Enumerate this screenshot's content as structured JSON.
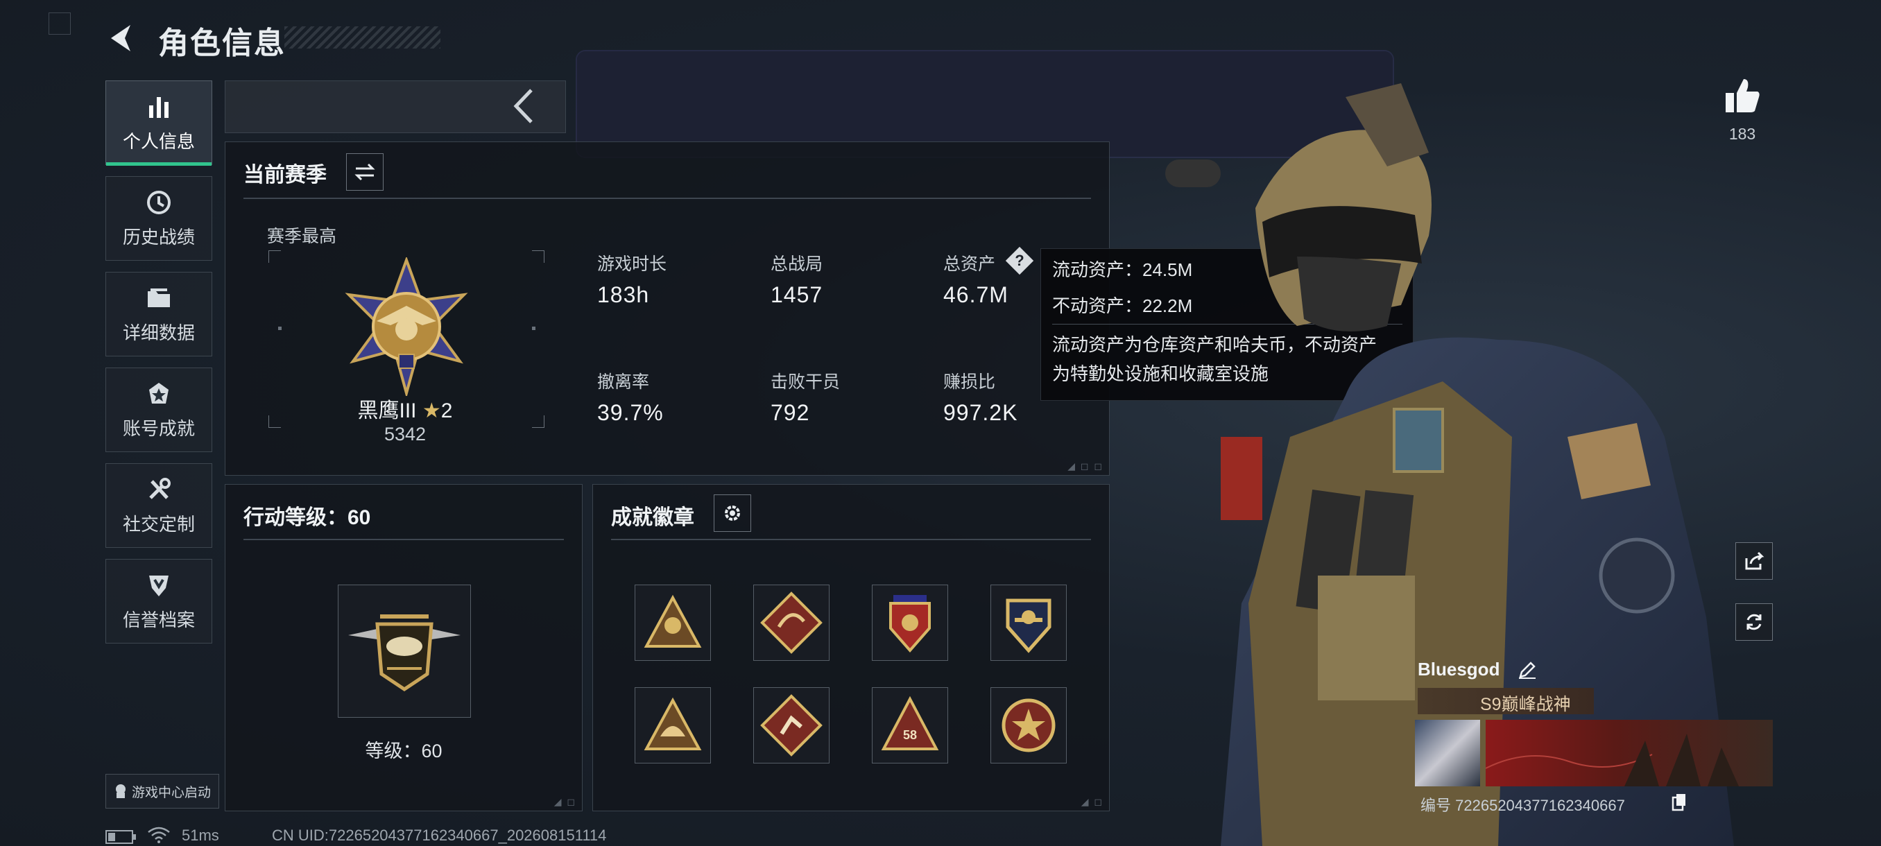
{
  "header": {
    "title": "角色信息"
  },
  "sidebar": {
    "items": [
      {
        "label": "个人信息",
        "icon": "bar-chart-icon",
        "active": true
      },
      {
        "label": "历史战绩",
        "icon": "history-clock-icon"
      },
      {
        "label": "详细数据",
        "icon": "folder-icon"
      },
      {
        "label": "账号成就",
        "icon": "achievement-icon"
      },
      {
        "label": "社交定制",
        "icon": "tools-icon"
      },
      {
        "label": "信誉档案",
        "icon": "shield-credit-icon"
      }
    ],
    "launch_label": "游戏中心启动"
  },
  "season": {
    "title": "当前赛季",
    "best_label": "赛季最高",
    "rank_name": "黑鹰III",
    "rank_stars": "2",
    "rank_points": "5342",
    "stats": [
      {
        "label": "游戏时长",
        "value": "183h"
      },
      {
        "label": "总战局",
        "value": "1457"
      },
      {
        "label": "总资产",
        "value": "46.7M"
      },
      {
        "label": "撤离率",
        "value": "39.7%"
      },
      {
        "label": "击败干员",
        "value": "792"
      },
      {
        "label": "赚损比",
        "value": "997.2K"
      }
    ]
  },
  "tooltip": {
    "liquid": "流动资产：24.5M",
    "fixed": "不动资产：22.2M",
    "desc_line1": "流动资产为仓库资产和哈夫币，不动资产",
    "desc_line2": "为特勤处设施和收藏室设施"
  },
  "action_level": {
    "title": "行动等级：60",
    "level_text": "等级：60"
  },
  "badges": {
    "title": "成就徽章",
    "items": [
      "badge-triangle-soldier",
      "badge-dragon-diamond",
      "badge-red-shield",
      "badge-wings-shield",
      "badge-triangle-helmet",
      "badge-diamond-runner",
      "badge-triangle-58",
      "badge-star-circle"
    ],
    "badge_58_text": "58"
  },
  "profile": {
    "likes": "183",
    "username": "Bluesgod",
    "title_tag": "S9巅峰战神",
    "id_label": "编号",
    "id_value": "7226520437716234066​7"
  },
  "status": {
    "ping": "51ms",
    "uid_text": "CN UID:72265204377162340667_202608151114"
  },
  "colors": {
    "accent_green": "#31c48d",
    "gold": "#c9a55a"
  }
}
